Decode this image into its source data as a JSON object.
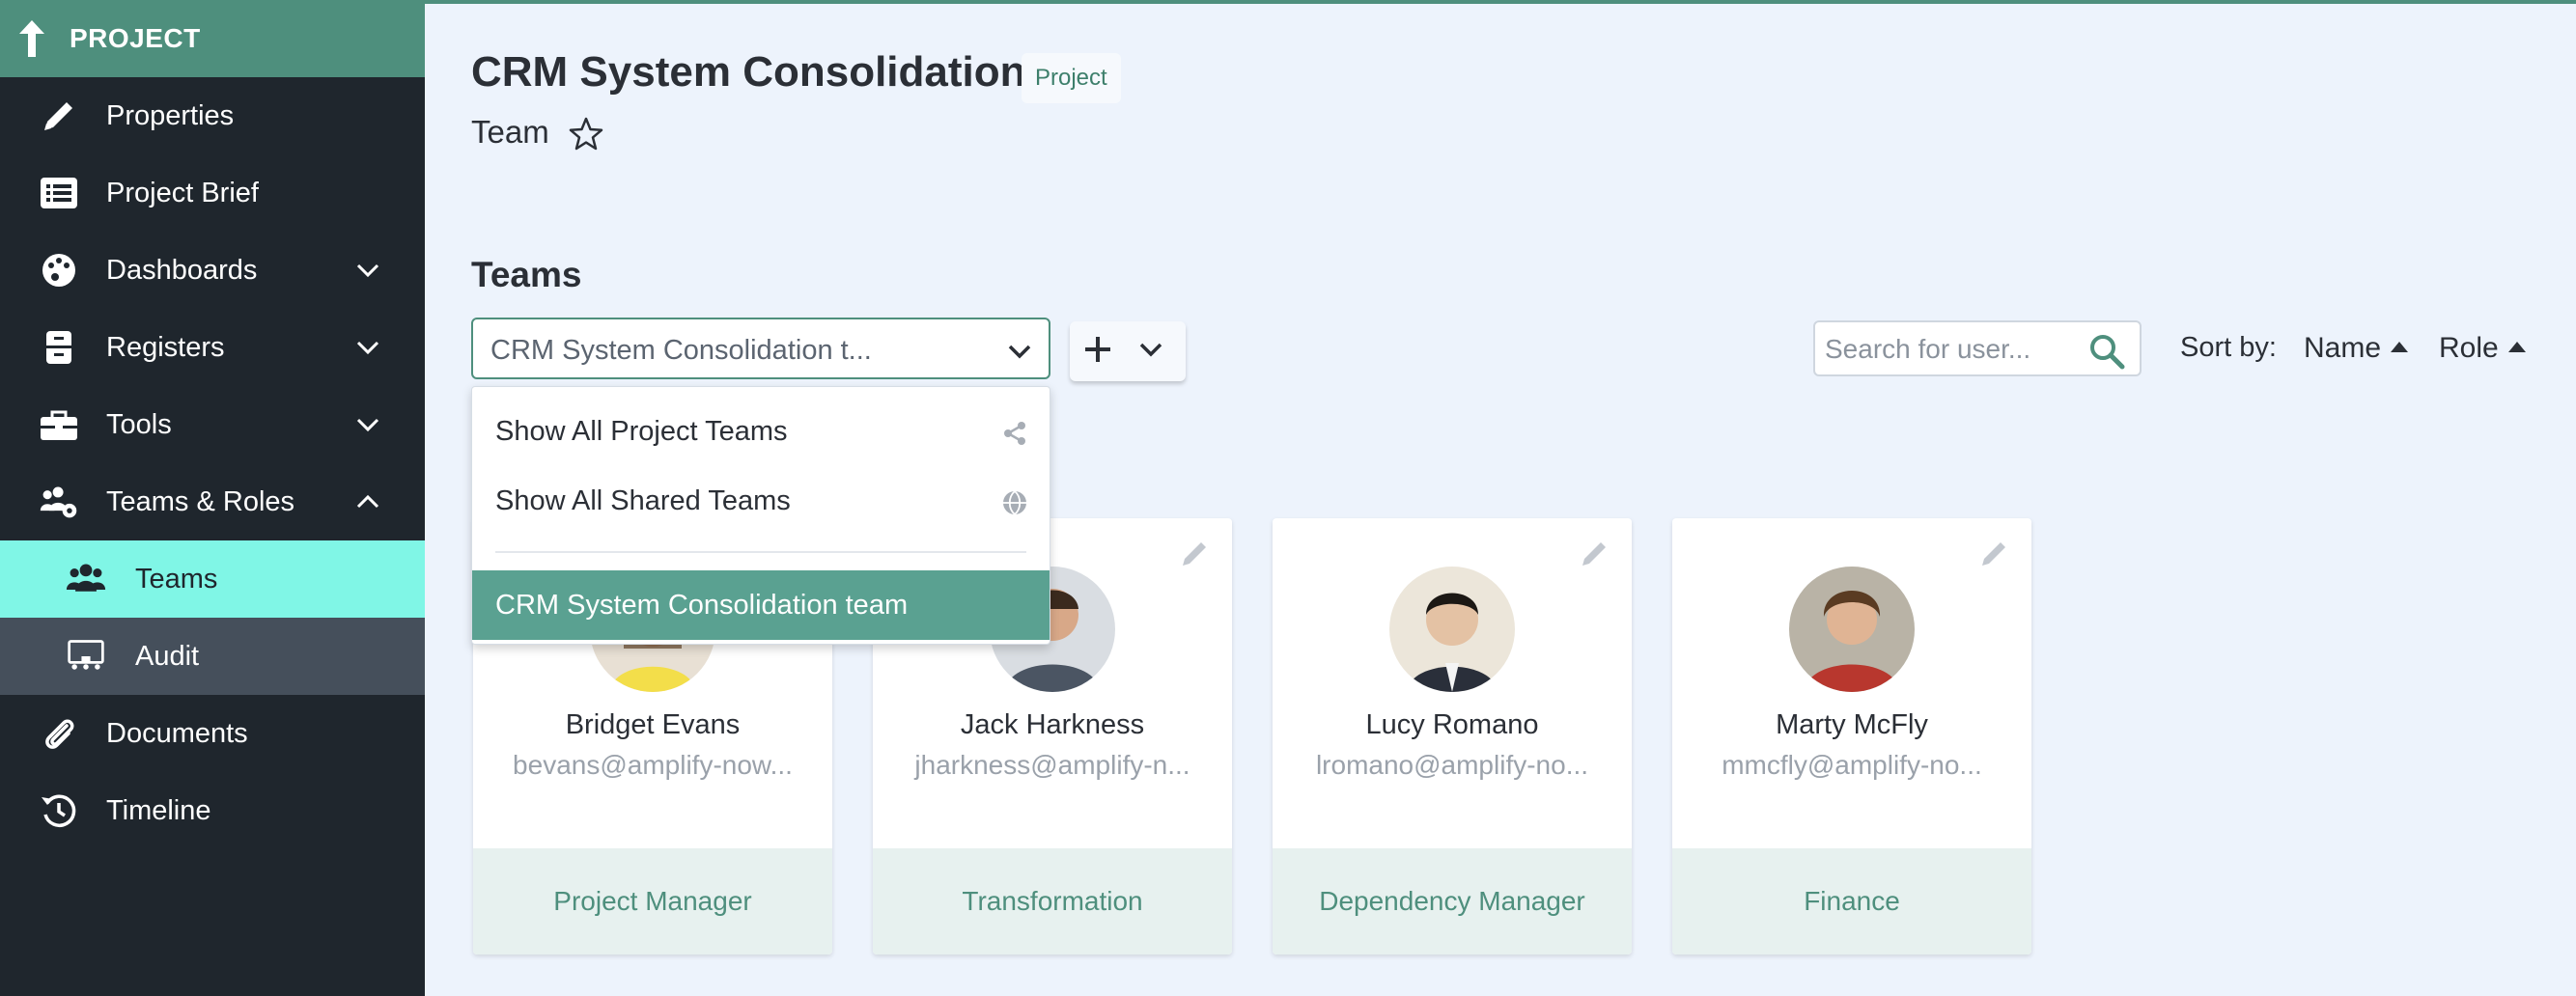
{
  "sidebar": {
    "header": "PROJECT",
    "items": [
      {
        "label": "Properties"
      },
      {
        "label": "Project Brief"
      },
      {
        "label": "Dashboards"
      },
      {
        "label": "Registers"
      },
      {
        "label": "Tools"
      },
      {
        "label": "Teams & Roles"
      },
      {
        "label": "Teams"
      },
      {
        "label": "Audit"
      },
      {
        "label": "Documents"
      },
      {
        "label": "Timeline"
      }
    ]
  },
  "header": {
    "title": "CRM System Consolidation",
    "tag": "Project",
    "subtitle": "Team"
  },
  "teams": {
    "title": "Teams",
    "selected": "CRM System Consolidation t...",
    "menu": [
      {
        "label": "Show All Project Teams",
        "icon": "share-icon"
      },
      {
        "label": "Show All Shared Teams",
        "icon": "globe-icon"
      },
      {
        "label": "CRM System Consolidation team"
      }
    ]
  },
  "search": {
    "placeholder": "Search for user..."
  },
  "sort": {
    "label": "Sort by:",
    "options": [
      "Name",
      "Role"
    ]
  },
  "members": [
    {
      "name": "Bridget Evans",
      "email": "bevans@amplify-now...",
      "role": "Project Manager"
    },
    {
      "name": "Jack Harkness",
      "email": "jharkness@amplify-n...",
      "role": "Transformation"
    },
    {
      "name": "Lucy Romano",
      "email": "lromano@amplify-no...",
      "role": "Dependency Manager"
    },
    {
      "name": "Marty McFly",
      "email": "mmcfly@amplify-no...",
      "role": "Finance"
    }
  ],
  "colors": {
    "accent": "#4e8f7d",
    "sidebar": "#1f262d",
    "active": "#80f6e6",
    "background": "#edf3fc"
  }
}
